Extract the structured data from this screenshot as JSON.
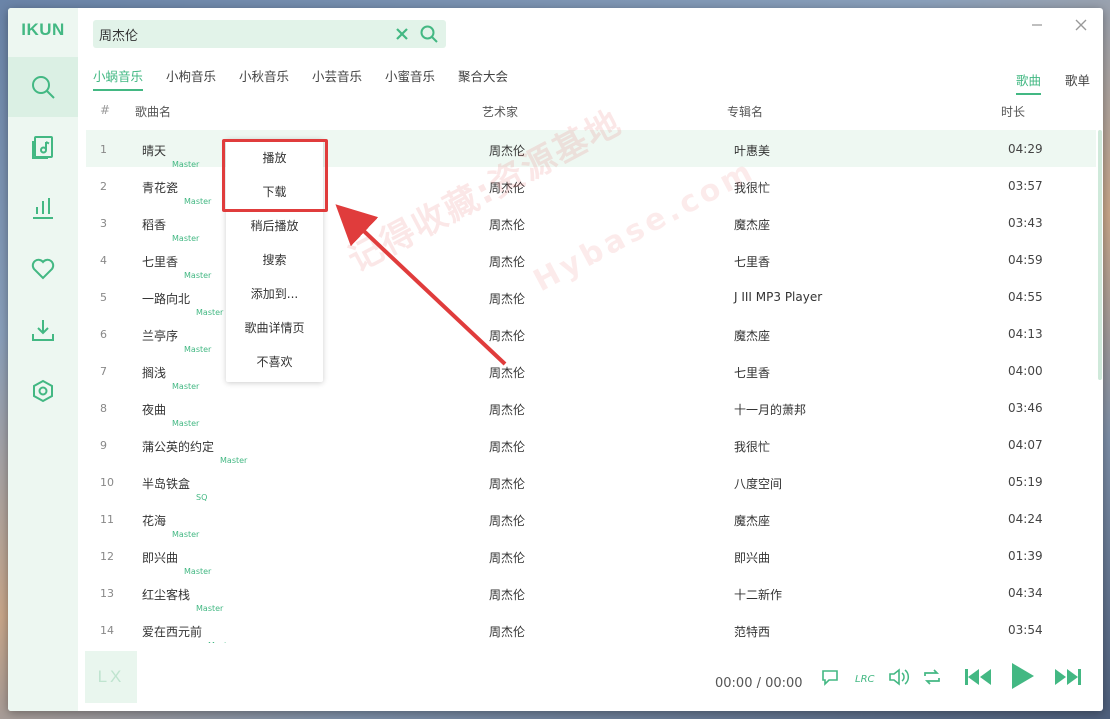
{
  "app": {
    "logo": "IKUN",
    "corner_logo": "LX"
  },
  "search": {
    "value": "周杰伦"
  },
  "sources": [
    "小蜗音乐",
    "小枸音乐",
    "小秋音乐",
    "小芸音乐",
    "小蜜音乐",
    "聚合大会"
  ],
  "active_source": "小蜗音乐",
  "types": [
    "歌曲",
    "歌单"
  ],
  "active_type": "歌曲",
  "table": {
    "headers": {
      "index": "#",
      "name": "歌曲名",
      "artist": "艺术家",
      "album": "专辑名",
      "duration": "时长"
    },
    "rows": [
      {
        "index": "1",
        "name": "晴天",
        "quality": "Master",
        "artist": "周杰伦",
        "album": "叶惠美",
        "duration": "04:29"
      },
      {
        "index": "2",
        "name": "青花瓷",
        "quality": "Master",
        "artist": "周杰伦",
        "album": "我很忙",
        "duration": "03:57"
      },
      {
        "index": "3",
        "name": "稻香",
        "quality": "Master",
        "artist": "周杰伦",
        "album": "魔杰座",
        "duration": "03:43"
      },
      {
        "index": "4",
        "name": "七里香",
        "quality": "Master",
        "artist": "周杰伦",
        "album": "七里香",
        "duration": "04:59"
      },
      {
        "index": "5",
        "name": "一路向北",
        "quality": "Master",
        "artist": "周杰伦",
        "album": "J III MP3 Player",
        "duration": "04:55"
      },
      {
        "index": "6",
        "name": "兰亭序",
        "quality": "Master",
        "artist": "周杰伦",
        "album": "魔杰座",
        "duration": "04:13"
      },
      {
        "index": "7",
        "name": "搁浅",
        "quality": "Master",
        "artist": "周杰伦",
        "album": "七里香",
        "duration": "04:00"
      },
      {
        "index": "8",
        "name": "夜曲",
        "quality": "Master",
        "artist": "周杰伦",
        "album": "十一月的萧邦",
        "duration": "03:46"
      },
      {
        "index": "9",
        "name": "蒲公英的约定",
        "quality": "Master",
        "artist": "周杰伦",
        "album": "我很忙",
        "duration": "04:07"
      },
      {
        "index": "10",
        "name": "半岛铁盒",
        "quality": "SQ",
        "artist": "周杰伦",
        "album": "八度空间",
        "duration": "05:19"
      },
      {
        "index": "11",
        "name": "花海",
        "quality": "Master",
        "artist": "周杰伦",
        "album": "魔杰座",
        "duration": "04:24"
      },
      {
        "index": "12",
        "name": "即兴曲",
        "quality": "Master",
        "artist": "周杰伦",
        "album": "即兴曲",
        "duration": "01:39"
      },
      {
        "index": "13",
        "name": "红尘客栈",
        "quality": "Master",
        "artist": "周杰伦",
        "album": "十二新作",
        "duration": "04:34"
      },
      {
        "index": "14",
        "name": "爱在西元前",
        "quality": "Master",
        "artist": "周杰伦",
        "album": "范特西",
        "duration": "03:54"
      }
    ]
  },
  "context_menu": [
    "播放",
    "下载",
    "稍后播放",
    "搜索",
    "添加到...",
    "歌曲详情页",
    "不喜欢"
  ],
  "watermark": {
    "line1": "记得收藏:资源基地",
    "line2": "Hybase.com"
  },
  "player": {
    "time": "00:00 / 00:00"
  },
  "colors": {
    "accent": "#43b883",
    "annotation": "#e03c3c"
  },
  "icons": {
    "nav": [
      "search-icon",
      "music-list-icon",
      "chart-icon",
      "heart-icon",
      "download-icon",
      "settings-icon"
    ],
    "player": [
      "comment-icon",
      "lyric-icon",
      "volume-icon",
      "repeat-icon",
      "prev-icon",
      "play-icon",
      "next-icon"
    ]
  }
}
